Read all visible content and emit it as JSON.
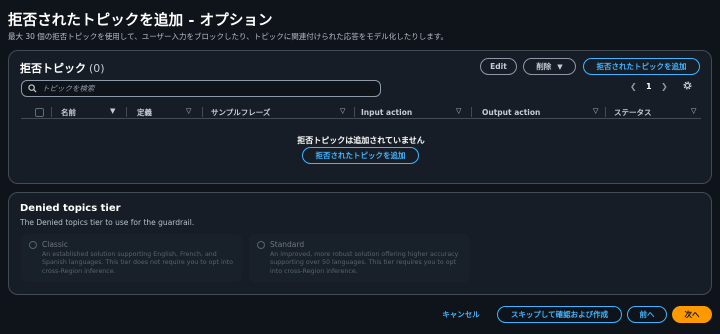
{
  "page": {
    "title": "拒否されたトピックを追加 - オプション",
    "subtitle": "最大 30 個の拒否トピックを使用して、ユーザー入力をブロックしたり、トピックに関連付けられた応答をモデル化したりします。"
  },
  "topics": {
    "heading": "拒否トピック",
    "count": "(0)",
    "edit_label": "Edit",
    "delete_label": "削除",
    "add_label": "拒否されたトピックを追加",
    "search_placeholder": "トピックを検索",
    "page_number": "1",
    "columns": [
      {
        "label": "名前"
      },
      {
        "label": "定義"
      },
      {
        "label": "サンプルフレーズ"
      },
      {
        "label": "Input action"
      },
      {
        "label": "Output action"
      },
      {
        "label": "ステータス"
      }
    ],
    "empty_message": "拒否トピックは追加されていません",
    "empty_add_label": "拒否されたトピックを追加"
  },
  "tier": {
    "heading": "Denied topics tier",
    "description": "The Denied topics tier to use for the guardrail.",
    "options": [
      {
        "name": "Classic",
        "description": "An established solution supporting English, French, and Spanish languages. This tier does not require you to opt into cross-Region inference."
      },
      {
        "name": "Standard",
        "description": "An improved, more robust solution offering higher accuracy supporting over 50 languages. This tier requires you to opt into cross-Region inference."
      }
    ]
  },
  "footer": {
    "cancel_label": "キャンセル",
    "skip_label": "スキップして確認および作成",
    "prev_label": "前へ",
    "next_label": "次へ"
  },
  "colors": {
    "accent": "#42b4ff",
    "primary": "#ff9900",
    "background": "#0f141a",
    "panel": "#161d26"
  }
}
